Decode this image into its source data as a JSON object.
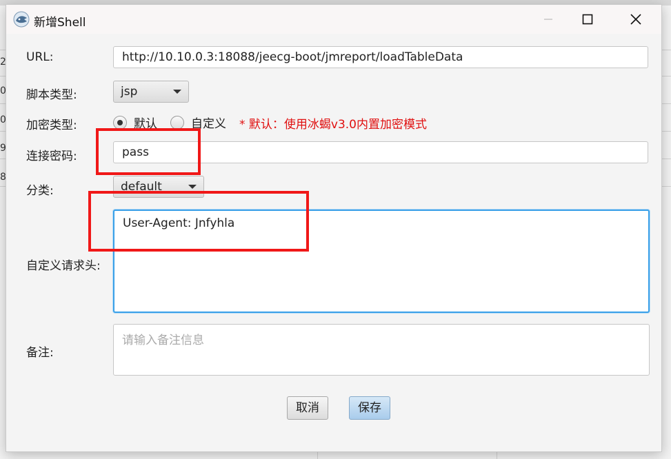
{
  "window": {
    "title": "新增Shell",
    "app_icon": "app-shell-icon",
    "controls": [
      "minimize-icon",
      "maximize-icon",
      "close-icon"
    ]
  },
  "background": {
    "row_fragments": [
      "2",
      "0",
      "0",
      "9",
      "8"
    ]
  },
  "form": {
    "url": {
      "label": "URL:",
      "value": "http://10.10.0.3:18088/jeecg-boot/jmreport/loadTableData"
    },
    "script_type": {
      "label": "脚本类型:",
      "selected": "jsp"
    },
    "encrypt_type": {
      "label": "加密类型:",
      "options": [
        {
          "label": "默认",
          "checked": true
        },
        {
          "label": "自定义",
          "checked": false
        }
      ],
      "hint": "* 默认：使用冰蝎v3.0内置加密模式"
    },
    "password": {
      "label": "连接密码:",
      "value": "pass"
    },
    "category": {
      "label": "分类:",
      "selected": "default"
    },
    "headers": {
      "label": "自定义请求头:",
      "value": "User-Agent: Jnfyhla"
    },
    "remark": {
      "label": "备注:",
      "placeholder": "请输入备注信息",
      "value": ""
    }
  },
  "buttons": {
    "cancel": "取消",
    "save": "保存"
  },
  "colors": {
    "accent": "#3aa0e8",
    "hint": "#e01010",
    "annotation": "#f01818",
    "primary_button": "#a9ccec"
  }
}
